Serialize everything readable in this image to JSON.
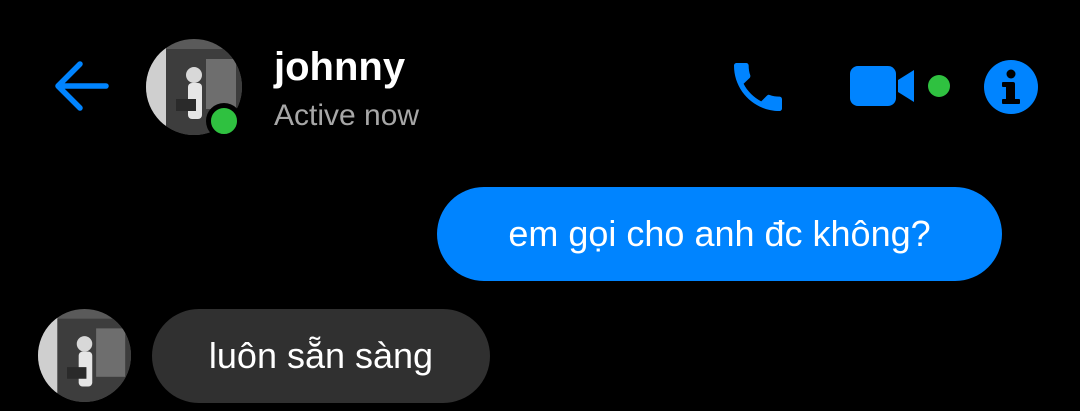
{
  "header": {
    "contact_name": "johnny",
    "status_text": "Active now",
    "icons": {
      "back": "arrow-left-icon",
      "call": "phone-icon",
      "video": "video-camera-icon",
      "info": "info-icon"
    }
  },
  "messages": [
    {
      "direction": "sent",
      "text": "em gọi cho anh đc không?"
    },
    {
      "direction": "received",
      "text": "luôn sẵn sàng"
    }
  ],
  "colors": {
    "background": "#000000",
    "accent": "#0084ff",
    "online": "#2fc140",
    "received_bubble": "#303030",
    "status_text": "#a7a7a7"
  }
}
